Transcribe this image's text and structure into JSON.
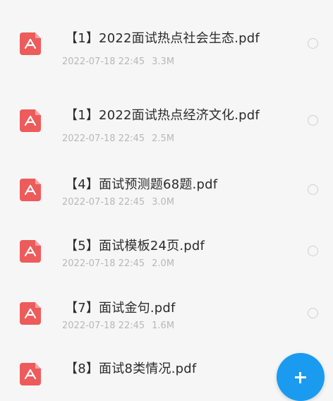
{
  "files": [
    {
      "name": "【1】2022面试热点社会生态.pdf",
      "date": "2022-07-18 22:45",
      "size": "3.3M"
    },
    {
      "name": "【1】2022面试热点经济文化.pdf",
      "date": "2022-07-18 22:45",
      "size": "2.5M"
    },
    {
      "name": "【4】面试预测题68题.pdf",
      "date": "2022-07-18 22:45",
      "size": "3.0M"
    },
    {
      "name": "【5】面试模板24页.pdf",
      "date": "2022-07-18 22:45",
      "size": "2.0M"
    },
    {
      "name": "【7】面试金句.pdf",
      "date": "2022-07-18 22:45",
      "size": "1.6M"
    },
    {
      "name": "【8】面试8类情况.pdf",
      "date": "",
      "size": ""
    }
  ],
  "icons": {
    "file_icon": "pdf-file-icon",
    "select_icon": "radio-circle-icon",
    "fab_icon": "plus-icon"
  },
  "colors": {
    "pdf_red": "#ee5b5b",
    "fab_blue": "#1a9bf0",
    "meta_gray": "#b8b8b8"
  }
}
